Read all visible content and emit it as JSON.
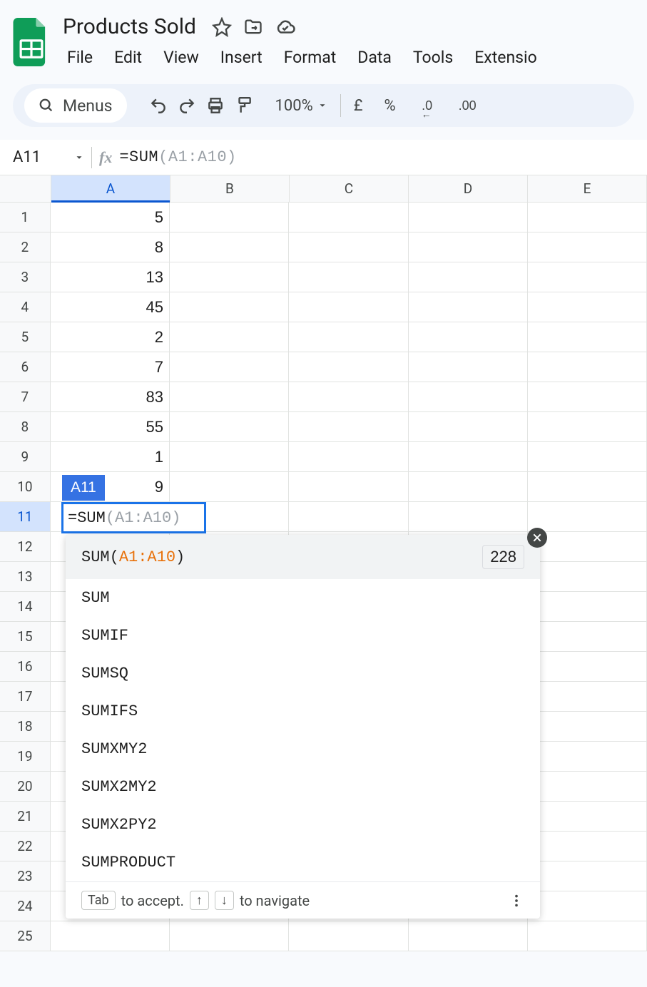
{
  "doc": {
    "title": "Products Sold"
  },
  "menu": [
    "File",
    "Edit",
    "View",
    "Insert",
    "Format",
    "Data",
    "Tools",
    "Extensio"
  ],
  "toolbar": {
    "search": "Menus",
    "zoom": "100%",
    "currency": "£",
    "percent": "%",
    "decrease": ".0",
    "increase": ".00"
  },
  "formula_bar": {
    "cell": "A11",
    "prefix": "=SUM",
    "ghost": "(A1:A10)"
  },
  "columns": [
    "A",
    "B",
    "C",
    "D",
    "E"
  ],
  "active_col_index": 0,
  "row_count": 25,
  "active_row": 11,
  "data_a": [
    "5",
    "8",
    "13",
    "45",
    "2",
    "7",
    "83",
    "55",
    "1",
    "9"
  ],
  "active_tag": "A11",
  "editing": {
    "typed": "=SUM",
    "ghost": "(A1:A10)"
  },
  "suggestions": {
    "first": {
      "prefix": "SUM(",
      "range": "A1:A10",
      "suffix": ")",
      "result": "228"
    },
    "rest": [
      "SUM",
      "SUMIF",
      "SUMSQ",
      "SUMIFS",
      "SUMXMY2",
      "SUMX2MY2",
      "SUMX2PY2",
      "SUMPRODUCT"
    ],
    "footer": {
      "tab_key": "Tab",
      "accept": "to accept.",
      "up": "↑",
      "down": "↓",
      "nav": "to navigate"
    }
  }
}
